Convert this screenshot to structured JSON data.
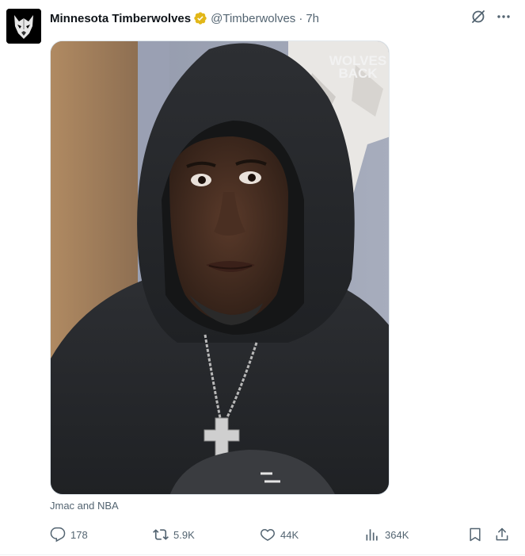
{
  "tweet": {
    "author_name": "Minnesota Timberwolves",
    "handle": "@Timberwolves",
    "separator": "·",
    "time": "7h",
    "caption": "Jmac and NBA",
    "media_overlay_line1": "WOLVES",
    "media_overlay_line2": "BACK"
  },
  "actions": {
    "replies": "178",
    "reposts": "5.9K",
    "likes": "44K",
    "views": "364K"
  },
  "icons": {
    "verified": "verified-badge-icon",
    "grok": "grok-icon",
    "more": "more-icon",
    "reply": "reply-icon",
    "repost": "repost-icon",
    "like": "like-icon",
    "views": "views-icon",
    "bookmark": "bookmark-icon",
    "share": "share-icon"
  },
  "colors": {
    "text_primary": "#0f1419",
    "text_secondary": "#536471",
    "verified_gold": "#e2b719",
    "divider": "#eff3f4"
  }
}
